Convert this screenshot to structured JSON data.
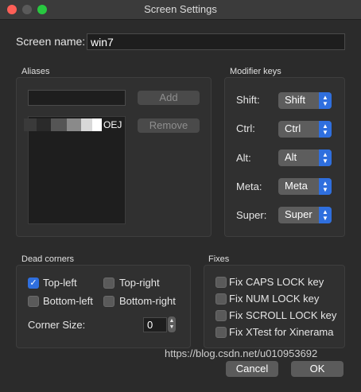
{
  "window": {
    "title": "Screen Settings"
  },
  "screen_name": {
    "label": "Screen name:",
    "value": "win7"
  },
  "aliases": {
    "title": "Aliases",
    "input_value": "",
    "add_label": "Add",
    "remove_label": "Remove",
    "items": [
      "OEJ"
    ]
  },
  "modifier_keys": {
    "title": "Modifier keys",
    "rows": [
      {
        "label": "Shift:",
        "value": "Shift"
      },
      {
        "label": "Ctrl:",
        "value": "Ctrl"
      },
      {
        "label": "Alt:",
        "value": "Alt"
      },
      {
        "label": "Meta:",
        "value": "Meta"
      },
      {
        "label": "Super:",
        "value": "Super"
      }
    ]
  },
  "dead_corners": {
    "title": "Dead corners",
    "top_left": {
      "label": "Top-left",
      "checked": true
    },
    "top_right": {
      "label": "Top-right",
      "checked": false
    },
    "bottom_left": {
      "label": "Bottom-left",
      "checked": false
    },
    "bottom_right": {
      "label": "Bottom-right",
      "checked": false
    },
    "corner_size_label": "Corner Size:",
    "corner_size_value": "0"
  },
  "fixes": {
    "title": "Fixes",
    "items": [
      {
        "label": "Fix CAPS LOCK key",
        "checked": false
      },
      {
        "label": "Fix NUM LOCK key",
        "checked": false
      },
      {
        "label": "Fix SCROLL LOCK key",
        "checked": false
      },
      {
        "label": "Fix XTest for Xinerama",
        "checked": false
      }
    ]
  },
  "buttons": {
    "cancel_label": "Cancel",
    "ok_label": "OK"
  },
  "watermark": "https://blog.csdn.net/u010953692",
  "colors": {
    "accent": "#2f6fde",
    "background": "#2b2b2b"
  }
}
